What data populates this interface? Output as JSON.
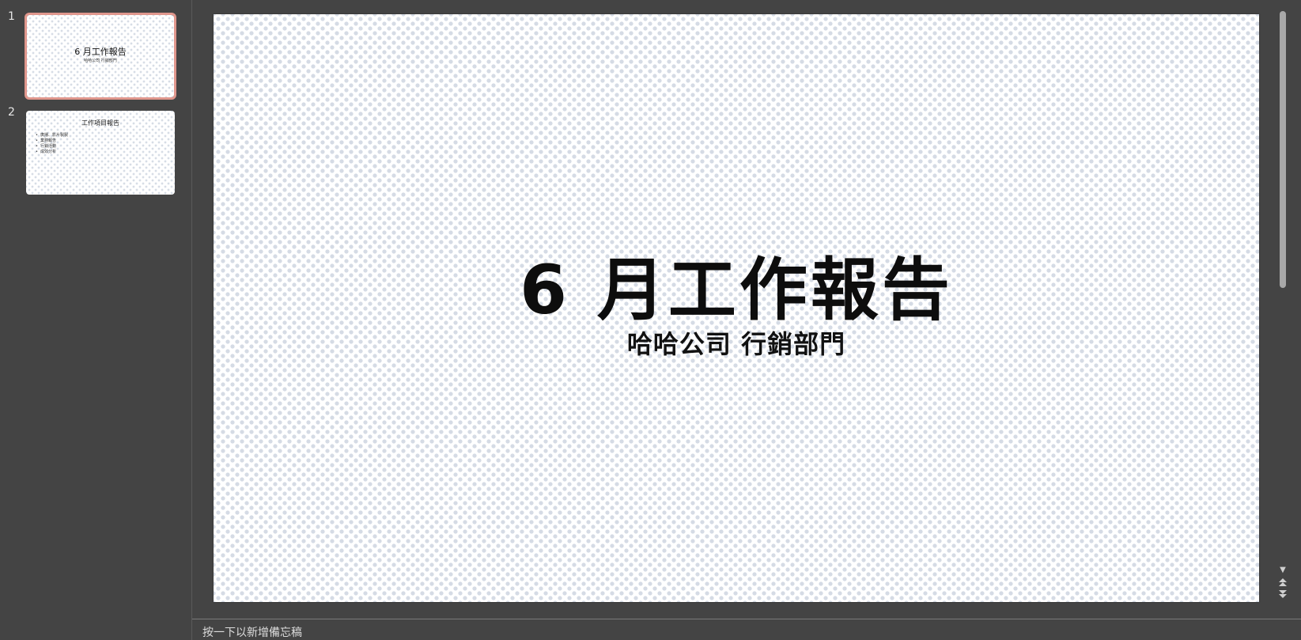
{
  "thumbnails": [
    {
      "number": "1",
      "title": "6 月工作報告",
      "subtitle": "哈哈公司 行銷部門",
      "selected": true
    },
    {
      "number": "2",
      "title": "工作項目報告",
      "items": [
        "廣播、影片製製",
        "業務報告",
        "行銷活動",
        "成效分析"
      ],
      "selected": false
    }
  ],
  "slide": {
    "title": "6 月工作報告",
    "subtitle": "哈哈公司 行銷部門"
  },
  "notes": {
    "placeholder": "按一下以新增備忘稿"
  },
  "colors": {
    "background": "#444444",
    "selection_border": "#e0978d",
    "pattern_dot": "#d5dbe5"
  },
  "icons": {
    "scroll_down": "triangle-down-icon",
    "prev_slide": "double-up-icon",
    "next_slide": "double-down-icon"
  }
}
